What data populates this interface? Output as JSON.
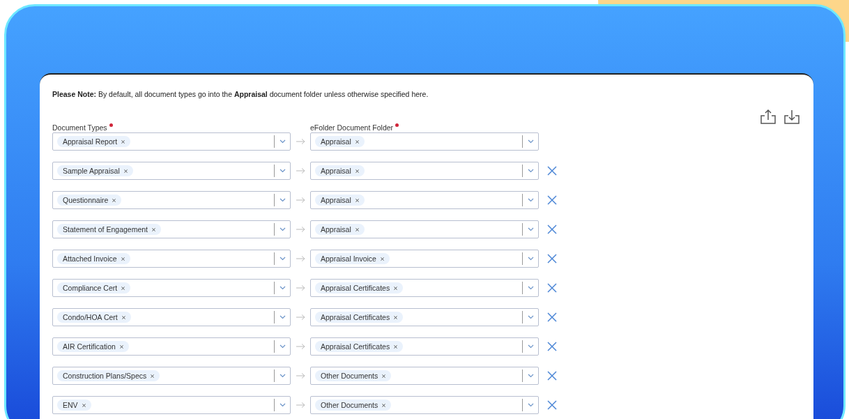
{
  "note": "**Please Note:** By default, all document types go into the **Appraisal** document folder unless otherwise specified here.",
  "columns": {
    "left": "Document Types",
    "right": "eFolder Document Folder",
    "required": true
  },
  "mappings": [
    {
      "document_type": "Appraisal Report",
      "folder": "Appraisal",
      "removable": false
    },
    {
      "document_type": "Sample Appraisal",
      "folder": "Appraisal",
      "removable": true
    },
    {
      "document_type": "Questionnaire",
      "folder": "Appraisal",
      "removable": true
    },
    {
      "document_type": "Statement of Engagement",
      "folder": "Appraisal",
      "removable": true
    },
    {
      "document_type": "Attached Invoice",
      "folder": "Appraisal Invoice",
      "removable": true
    },
    {
      "document_type": "Compliance Cert",
      "folder": "Appraisal Certificates",
      "removable": true
    },
    {
      "document_type": "Condo/HOA Cert",
      "folder": "Appraisal Certificates",
      "removable": true
    },
    {
      "document_type": "AIR Certification",
      "folder": "Appraisal Certificates",
      "removable": true
    },
    {
      "document_type": "Construction Plans/Specs",
      "folder": "Other Documents",
      "removable": true
    },
    {
      "document_type": "ENV",
      "folder": "Other Documents",
      "removable": true
    }
  ]
}
